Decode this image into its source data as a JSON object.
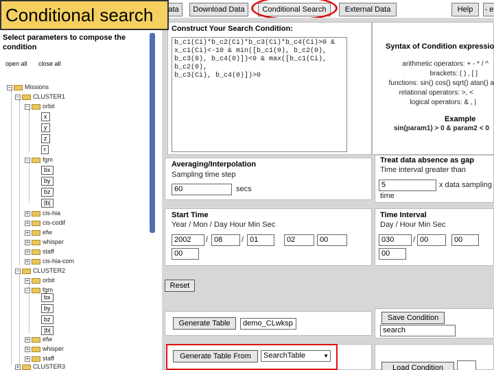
{
  "slide_title": "Conditional search",
  "tabs": {
    "data_partial": "ata",
    "download": "Download Data",
    "conditional": "Conditional Search",
    "external": "External Data",
    "help": "Help",
    "partial_right": "- e"
  },
  "left": {
    "heading": "Select parameters to compose the condition",
    "expand_all": "open all",
    "close_all": "close all",
    "tree": {
      "missions": "Missions",
      "cluster1": "CLUSTER1",
      "orbit": "orbit",
      "orbit_x": "x",
      "orbit_y": "y",
      "orbit_z": "z",
      "orbit_r": "r",
      "fgm": "fgm",
      "fgm_bx": "bx",
      "fgm_by": "by",
      "fgm_bz": "bz",
      "fgm_b": "|b|",
      "cis_hia": "cis-hia",
      "cis_codif": "cis-codif",
      "efw": "efw",
      "whisper": "whisper",
      "staff": "staff",
      "cis_hia_com": "cis-hia-com",
      "cluster2": "CLUSTER2",
      "c2_orbit": "orbit",
      "c2_fgm": "fgm",
      "c2_bx": "bx",
      "c2_by": "by",
      "c2_bz": "bz",
      "c2_b": "|b|",
      "c2_efw": "efw",
      "c2_whisper": "whisper",
      "c2_staff": "staff",
      "cluster3": "CLUSTER3"
    }
  },
  "construct": {
    "title": "Construct Your Search Condition:",
    "code": "b_c1(Ci)*b_c2(Ci)*b_c3(Ci)*b_c4(Ci)>0 &\nx_c1(Ci)<-10 & min([b_c1(0), b_c2(0),\nb_c3(0), b_c4(0)])<0 & max([b_c1(Ci), b_c2(0),\nb_c3(Ci), b_c4(0)])>0"
  },
  "syntax": {
    "title": "Syntax of Condition expressio",
    "arith": "arithmetic operators: + - * / ^",
    "brackets": "brackets: ( ) , [ ]",
    "functions": "functions: sin() cos() sqrt() atan() a",
    "relational": "relational operators: >, <",
    "logical": "logical operators: & , |",
    "example_title": "Example",
    "example": "sin(param1) > 0 & param2 < 0"
  },
  "averaging": {
    "title": "Averaging/Interpolation",
    "step_label": "Sampling time step",
    "step_value": "60",
    "unit": "secs"
  },
  "gap": {
    "title": "Treat data absence as gap",
    "line1": "Time interval greater than",
    "value": "5",
    "line2": "x data sampling",
    "line3": "time"
  },
  "start_time": {
    "title": "Start Time",
    "header": "Year / Mon / Day  Hour  Min  Sec",
    "year": "2002",
    "mon": "08",
    "day": "01",
    "hour": "02",
    "min": "00",
    "sec": "00"
  },
  "interval": {
    "title": "Time Interval",
    "header": "Day / Hour  Min  Sec",
    "day": "030",
    "hour": "00",
    "min": "00",
    "sec": "00"
  },
  "reset_label": "Reset",
  "generate_table_label": "Generate Table",
  "table_name": "demo_CLwksp",
  "save_condition_label": "Save Condition",
  "save_name": "search",
  "generate_from_label": "Generate Table From",
  "generate_from_selected": "SearchTable",
  "load_condition_label": "Load Condition"
}
